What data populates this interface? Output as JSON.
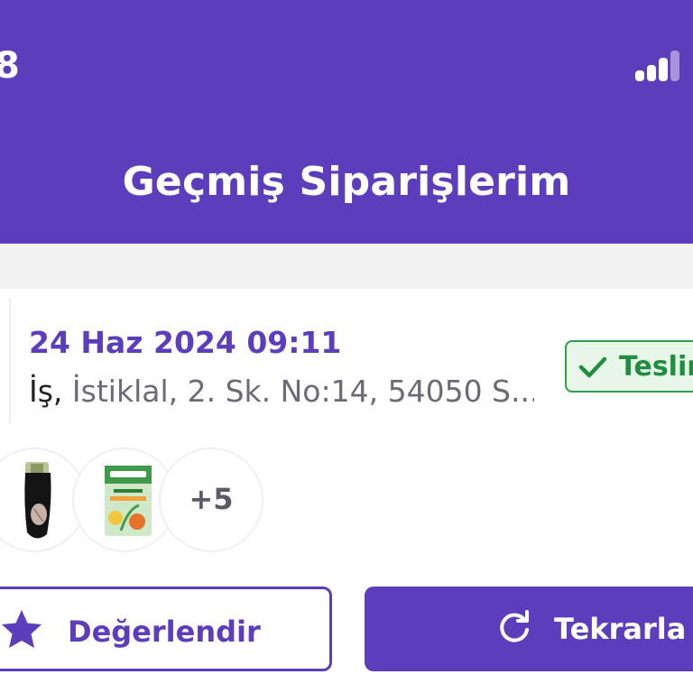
{
  "status_bar": {
    "time_fragment": "8",
    "signal_icon": "signal-bars-icon"
  },
  "header": {
    "title": "Geçmiş Siparişlerim",
    "background_color": "#5c3ebd"
  },
  "order": {
    "date": "24 Haz 2024 09:11",
    "address_label": "İş,",
    "address_text": "İstiklal, 2. Sk. No:14, 54050 S...",
    "status": {
      "label": "Teslim",
      "icon": "check-icon",
      "color": "#1f8e3e"
    },
    "items": [
      {
        "icon": "sock-product-image"
      },
      {
        "icon": "tea-box-product-image"
      }
    ],
    "more_count": "+5"
  },
  "actions": {
    "rate_label": "Değerlendir",
    "rate_icon": "star-icon",
    "repeat_label": "Tekrarla",
    "repeat_icon": "refresh-icon"
  }
}
